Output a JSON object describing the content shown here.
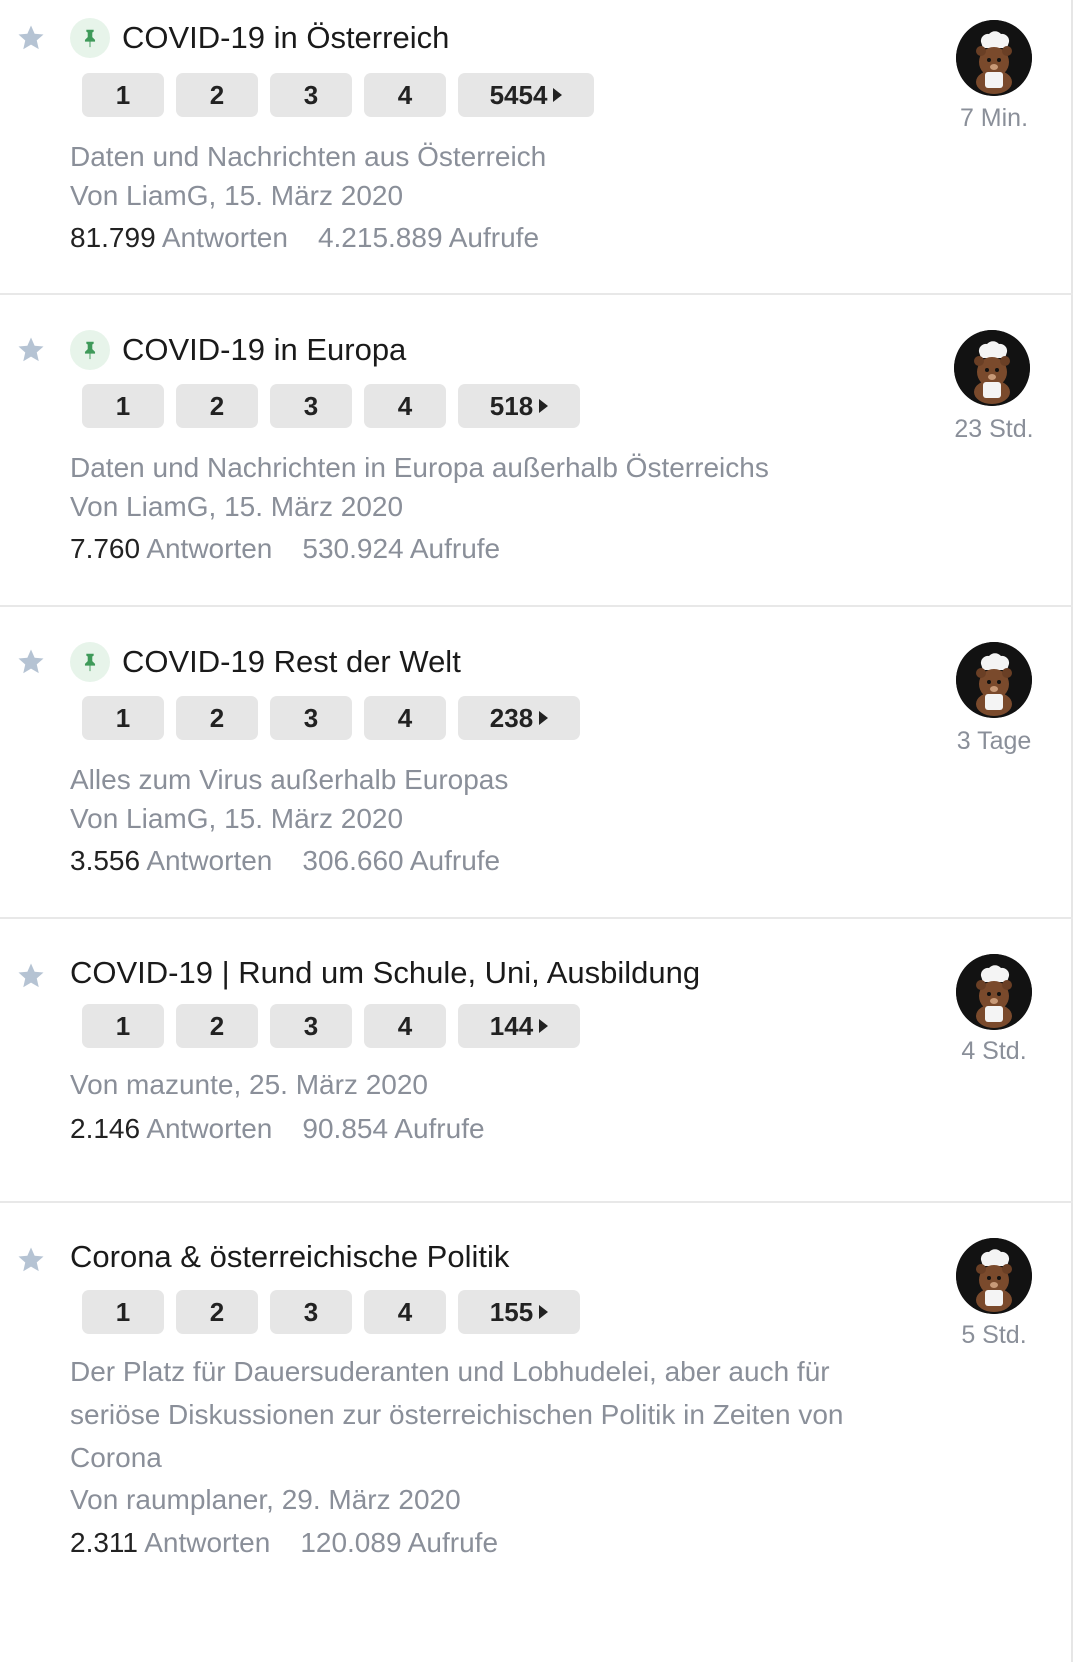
{
  "threads": [
    {
      "title": "COVID-19 in Österreich",
      "pinned": true,
      "pages": [
        "1",
        "2",
        "3",
        "4",
        "5454"
      ],
      "description": "Daten und Nachrichten aus Österreich",
      "byline": "Von LiamG, 15. März 2020",
      "replies": "81.799",
      "replies_label": "Antworten",
      "views_text": "4.215.889 Aufrufe",
      "last_post": "7 Min."
    },
    {
      "title": "COVID-19 in Europa",
      "pinned": true,
      "pages": [
        "1",
        "2",
        "3",
        "4",
        "518"
      ],
      "description": "Daten und Nachrichten in Europa außerhalb Österreichs",
      "byline": "Von LiamG, 15. März 2020",
      "replies": "7.760",
      "replies_label": "Antworten",
      "views_text": "530.924 Aufrufe",
      "last_post": "23 Std."
    },
    {
      "title": "COVID-19 Rest der Welt",
      "pinned": true,
      "pages": [
        "1",
        "2",
        "3",
        "4",
        "238"
      ],
      "description": "Alles zum Virus außerhalb Europas",
      "byline": "Von LiamG, 15. März 2020",
      "replies": "3.556",
      "replies_label": "Antworten",
      "views_text": "306.660 Aufrufe",
      "last_post": "3 Tage"
    },
    {
      "title": "COVID-19 | Rund um Schule, Uni, Ausbildung",
      "pinned": false,
      "pages": [
        "1",
        "2",
        "3",
        "4",
        "144"
      ],
      "description": "",
      "byline": "Von mazunte, 25. März 2020",
      "replies": "2.146",
      "replies_label": "Antworten",
      "views_text": "90.854 Aufrufe",
      "last_post": "4 Std."
    },
    {
      "title": "Corona & österreichische Politik",
      "pinned": false,
      "pages": [
        "1",
        "2",
        "3",
        "4",
        "155"
      ],
      "description": "Der Platz für Dauersuderanten und Lobhudelei, aber auch für seriöse Diskussionen zur österreichischen Politik in Zeiten von Corona",
      "byline": "Von raumplaner, 29. März 2020",
      "replies": "2.311",
      "replies_label": "Antworten",
      "views_text": "120.089 Aufrufe",
      "last_post": "5 Std."
    }
  ],
  "colors": {
    "muted_text": "#8a8f99",
    "pin_green": "#3f9a5a",
    "star_gray": "#b5c3d3",
    "page_button_bg": "#e6e6e6"
  },
  "icons": {
    "star": "star-icon",
    "pin": "pin-icon",
    "page_next": "caret-right-icon",
    "avatar": "bear-chef-avatar"
  }
}
